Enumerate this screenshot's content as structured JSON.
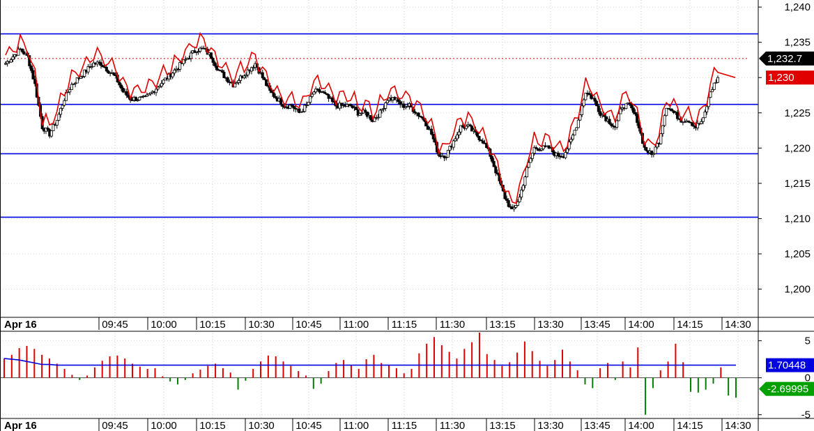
{
  "chart_data": [
    {
      "type": "candlestick",
      "date_label": "Apr 16",
      "time_labels": [
        "09:45",
        "10:00",
        "10:15",
        "10:30",
        "10:45",
        "11:00",
        "11:15",
        "11:30",
        "13:15",
        "13:30",
        "13:45",
        "14:00",
        "14:15",
        "14:30"
      ],
      "ylim": [
        1196,
        1241
      ],
      "y_ticks": [
        1200,
        1205,
        1210,
        1215,
        1220,
        1225,
        1230,
        1235,
        1240
      ],
      "y_tick_labels": [
        "1,200",
        "1,205",
        "1,210",
        "1,215",
        "1,220",
        "1,225",
        "1,230",
        "1,235",
        "1,240"
      ],
      "horizontal_lines": [
        1236.2,
        1226.2,
        1219.2,
        1210.2
      ],
      "dotted_line": 1232.7,
      "last_price_label": "1,232.7",
      "red_line_label": "1,230",
      "close_path": [
        1232,
        1233,
        1234,
        1233,
        1229,
        1223,
        1222,
        1224,
        1227,
        1229,
        1230,
        1231,
        1232,
        1232,
        1231,
        1230,
        1228,
        1227,
        1227,
        1227,
        1228,
        1229,
        1230,
        1231,
        1232,
        1233,
        1234,
        1234,
        1233,
        1231,
        1230,
        1229,
        1230,
        1231,
        1232,
        1230,
        1228,
        1227,
        1226,
        1226,
        1225,
        1226,
        1228,
        1228,
        1227,
        1226,
        1226,
        1226,
        1225,
        1225,
        1224,
        1225,
        1227,
        1227,
        1226,
        1226,
        1225,
        1224,
        1222,
        1219,
        1219,
        1221,
        1223,
        1223,
        1222,
        1221,
        1219,
        1216,
        1213,
        1211,
        1213,
        1217,
        1220,
        1220,
        1220,
        1219,
        1219,
        1221,
        1224,
        1228,
        1227,
        1225,
        1224,
        1223,
        1226,
        1226,
        1224,
        1220,
        1219,
        1221,
        1226,
        1225,
        1224,
        1224,
        1223,
        1224,
        1228,
        1230
      ]
    },
    {
      "type": "bar",
      "date_label": "Apr 16",
      "time_labels": [
        "09:45",
        "10:00",
        "10:15",
        "10:30",
        "10:45",
        "11:00",
        "11:15",
        "11:30",
        "13:15",
        "13:30",
        "13:45",
        "14:00",
        "14:15",
        "14:30"
      ],
      "ylim": [
        -5.5,
        6
      ],
      "y_ticks": [
        5,
        0,
        -5
      ],
      "y_tick_labels": [
        "5",
        "0",
        "-5"
      ],
      "ma_label": "1.70448",
      "last_value_label": "-2.69995",
      "values": [
        2.6,
        3.1,
        4.0,
        4.3,
        3.9,
        3.1,
        2.6,
        1.9,
        1.2,
        0.4,
        -0.3,
        0.3,
        1.4,
        2.3,
        2.9,
        3.0,
        2.6,
        1.9,
        1.5,
        1.2,
        1.3,
        0.2,
        -0.5,
        -0.9,
        -0.3,
        0.6,
        1.1,
        1.6,
        1.9,
        1.3,
        0.7,
        -1.6,
        -0.4,
        1.2,
        2.2,
        3.0,
        2.9,
        2.2,
        1.6,
        0.9,
        0.3,
        -1.5,
        -0.8,
        0.9,
        2.0,
        2.4,
        1.7,
        1.2,
        2.5,
        3.1,
        2.0,
        1.7,
        1.3,
        0.6,
        1.2,
        3.3,
        4.6,
        5.5,
        4.4,
        3.5,
        2.6,
        3.9,
        4.8,
        6.1,
        3.2,
        2.4,
        1.6,
        2.1,
        3.4,
        4.9,
        3.6,
        2.3,
        1.6,
        2.4,
        3.8,
        2.2,
        1.0,
        -0.9,
        -1.4,
        1.3,
        2.0,
        -0.3,
        2.2,
        1.4,
        4.1,
        -5.0,
        -1.4,
        1.0,
        2.2,
        4.6,
        2.1,
        -1.9,
        -2.0,
        -1.6,
        -0.8,
        1.4,
        -2.4,
        -2.7
      ],
      "ma_values": [
        2.6,
        2.5,
        2.4,
        2.2,
        2.0,
        1.8,
        1.8,
        1.7,
        1.7,
        1.7,
        1.7,
        1.7,
        1.7,
        1.7,
        1.7,
        1.7,
        1.7,
        1.7,
        1.7,
        1.7,
        1.7,
        1.7,
        1.7,
        1.7,
        1.7,
        1.7,
        1.7,
        1.7,
        1.7,
        1.7,
        1.7,
        1.7,
        1.7,
        1.7,
        1.7,
        1.7,
        1.7,
        1.7,
        1.7,
        1.7,
        1.7,
        1.7,
        1.7,
        1.7,
        1.7,
        1.7,
        1.7,
        1.7,
        1.7,
        1.7,
        1.7,
        1.7,
        1.7,
        1.7,
        1.7,
        1.7,
        1.7,
        1.7,
        1.7,
        1.7,
        1.7,
        1.7,
        1.7,
        1.7,
        1.7,
        1.7,
        1.7,
        1.7,
        1.7,
        1.7,
        1.7,
        1.7,
        1.7,
        1.7,
        1.7,
        1.7,
        1.7,
        1.7,
        1.7,
        1.7,
        1.7,
        1.7,
        1.7,
        1.7,
        1.7,
        1.7,
        1.7,
        1.7,
        1.7,
        1.7,
        1.7,
        1.7,
        1.7,
        1.7,
        1.7,
        1.7,
        1.7,
        1.7
      ]
    }
  ]
}
